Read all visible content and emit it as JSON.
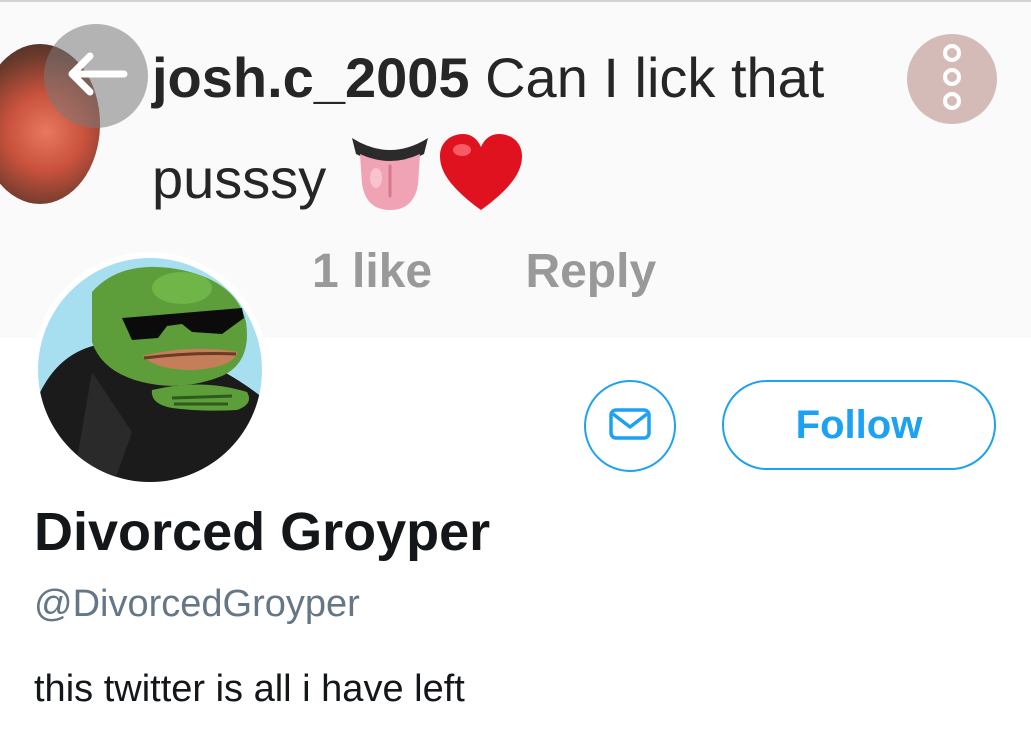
{
  "header": {
    "comment": {
      "username": "josh.c_2005",
      "text_line1": "Can I lick that",
      "text_line2": "pusssy",
      "likes": "1 like",
      "reply_label": "Reply"
    },
    "icons": {
      "back": "arrow-left-icon",
      "more": "more-vertical-icon"
    }
  },
  "profile": {
    "display_name": "Divorced Groyper",
    "handle": "@DivorcedGroyper",
    "bio": "this twitter is all i have left",
    "follow_label": "Follow",
    "message_icon": "envelope-icon"
  },
  "colors": {
    "accent": "#1da1f2",
    "text_primary": "#14171a",
    "text_secondary": "#657786"
  }
}
